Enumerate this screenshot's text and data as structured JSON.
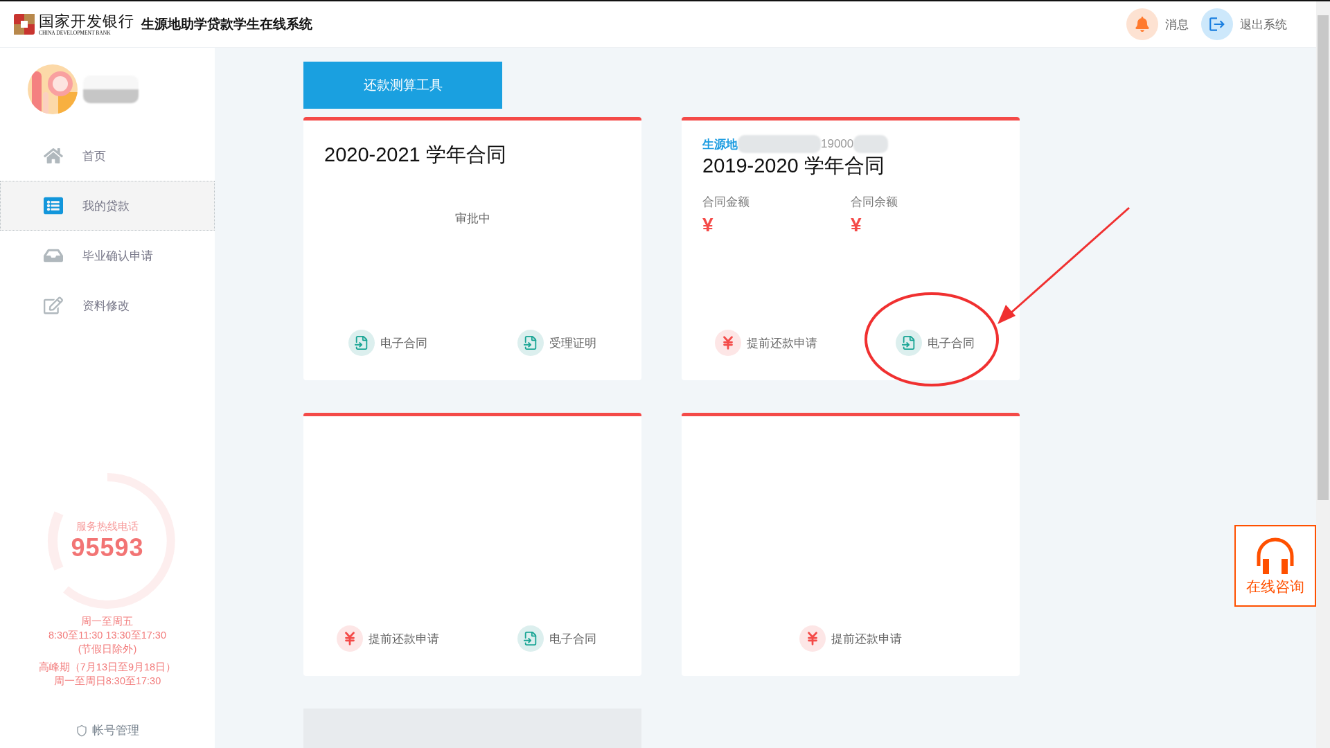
{
  "header": {
    "logo_cn": "国家开发银行",
    "logo_en": "CHINA DEVELOPMENT BANK",
    "system_title": "生源地助学贷款学生在线系统",
    "actions": [
      {
        "kind": "bell",
        "label": "消息"
      },
      {
        "kind": "logout",
        "label": "退出系统"
      }
    ]
  },
  "sidebar": {
    "nav": [
      {
        "kind": "home",
        "label": "首页",
        "selected": false
      },
      {
        "kind": "list",
        "label": "我的贷款",
        "selected": true
      },
      {
        "kind": "tray",
        "label": "毕业确认申请",
        "selected": false
      },
      {
        "kind": "edit",
        "label": "资料修改",
        "selected": false
      }
    ],
    "hotline": {
      "label": "服务热线电话",
      "number": "95593",
      "hours": [
        "周一至周五",
        "8:30至11:30 13:30至17:30",
        "(节假日除外)",
        "高峰期（7月13日至9月18日）",
        "周一至周日8:30至17:30"
      ]
    },
    "account": "帐号管理"
  },
  "tool_button": "还款测算工具",
  "contracts": [
    {
      "kind": "pending",
      "title": "2020-2021 学年合同",
      "status": "审批中",
      "actions": [
        {
          "kind": "doc",
          "label": "电子合同"
        },
        {
          "kind": "doc",
          "label": "受理证明"
        }
      ]
    },
    {
      "kind": "active",
      "tag": "生源地",
      "ref": "19000",
      "title": "2019-2020 学年合同",
      "fields": [
        {
          "label": "合同金额",
          "value": "¥"
        },
        {
          "label": "合同余额",
          "value": "¥"
        }
      ],
      "actions": [
        {
          "kind": "yen",
          "label": "提前还款申请"
        },
        {
          "kind": "doc",
          "label": "电子合同"
        }
      ]
    },
    {
      "kind": "empty",
      "actions": [
        {
          "kind": "yen",
          "label": "提前还款申请"
        },
        {
          "kind": "doc",
          "label": "电子合同"
        }
      ]
    },
    {
      "kind": "empty",
      "actions": [
        {
          "kind": "yen",
          "label": "提前还款申请"
        }
      ]
    },
    {
      "kind": "placeholder"
    }
  ],
  "consult": "在线咨询"
}
